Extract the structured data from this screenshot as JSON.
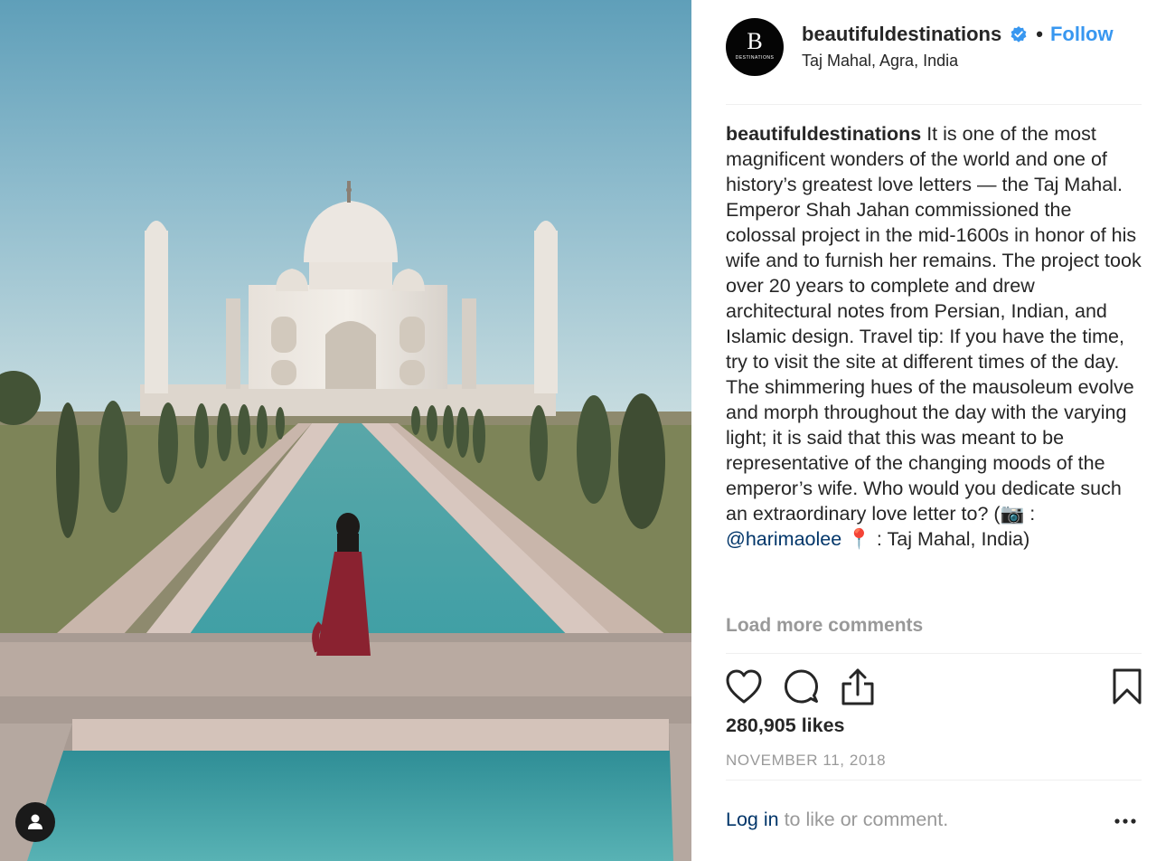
{
  "header": {
    "avatar_letter": "B",
    "avatar_subtext": "DESTINATIONS",
    "username": "beautifuldestinations",
    "separator": "•",
    "follow_label": "Follow",
    "location": "Taj Mahal, Agra, India",
    "verified_badge_icon": "verified-badge-icon"
  },
  "caption": {
    "author": "beautifuldestinations",
    "text": " It is one of the most magnificent wonders of the world and one of history’s greatest love letters — the Taj Mahal. Emperor Shah Jahan commissioned the colossal project in the mid-1600s in honor of his wife and to furnish her remains. The project took over 20 years to complete and drew architectural notes from Persian, Indian, and Islamic design. Travel tip: If you have the time, try to visit the site at different times of the day. The shimmering hues of the mausoleum evolve and morph throughout the day with the varying light; it is said that this was meant to be representative of the changing moods of the emperor’s wife. Who would you dedicate such an extraordinary love letter to? (",
    "camera_emoji": "📷",
    "mention_prefix": " : ",
    "mention": "@harimaolee",
    "pin_emoji": " 📍",
    "tail": " : Taj Mahal, India)"
  },
  "comments": {
    "load_more_label": "Load more comments"
  },
  "actions": {
    "like_icon": "heart-icon",
    "comment_icon": "comment-icon",
    "share_icon": "share-icon",
    "save_icon": "bookmark-icon"
  },
  "likes_text": "280,905 likes",
  "date": "NOVEMBER 11, 2018",
  "footer": {
    "login_label": "Log in",
    "prompt": " to like or comment.",
    "more_icon": "more-options-icon"
  },
  "media": {
    "description_icon": "photo",
    "user_tag_icon": "user-tag-icon"
  },
  "colors": {
    "link_blue": "#3897f0",
    "mention_navy": "#003569",
    "muted_gray": "#999999",
    "text": "#262626"
  }
}
